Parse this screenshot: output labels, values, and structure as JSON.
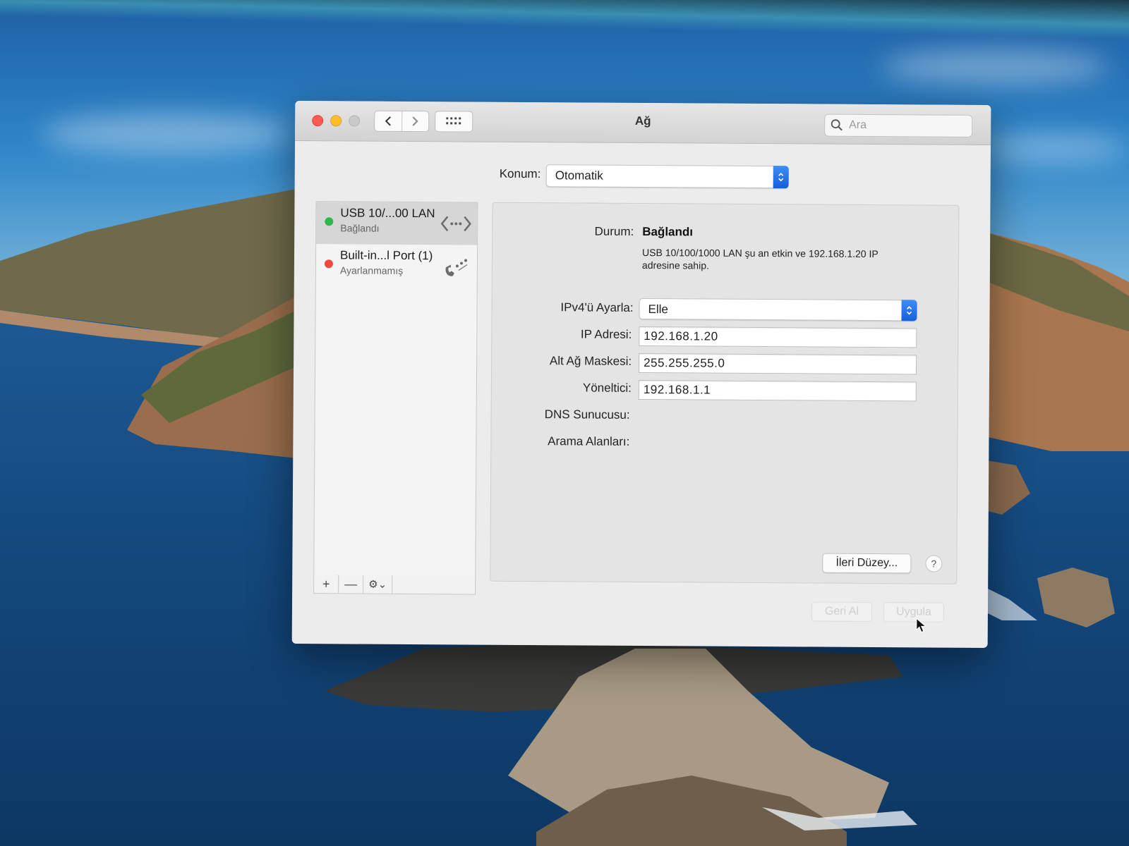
{
  "window": {
    "title": "Ağ",
    "search_placeholder": "Ara"
  },
  "location": {
    "label": "Konum:",
    "value": "Otomatik"
  },
  "services": [
    {
      "name": "USB 10/...00 LAN",
      "status": "Bağlandı",
      "status_color": "#2fb84a",
      "icon": "ethernet-icon",
      "selected": true
    },
    {
      "name": "Built-in...l Port (1)",
      "status": "Ayarlanmamış",
      "status_color": "#f04b3e",
      "icon": "phone-modem-icon",
      "selected": false
    }
  ],
  "sidebar_tools": {
    "add": "+",
    "remove": "—",
    "gear_caret": "⌄"
  },
  "detail": {
    "status_label": "Durum:",
    "status_value": "Bağlandı",
    "status_description": "USB 10/100/1000 LAN şu an etkin ve 192.168.1.20 IP adresine sahip.",
    "configure_ipv4_label": "IPv4'ü Ayarla:",
    "configure_ipv4_value": "Elle",
    "ip_label": "IP Adresi:",
    "ip_value": "192.168.1.20",
    "subnet_label": "Alt Ağ Maskesi:",
    "subnet_value": "255.255.255.0",
    "router_label": "Yöneltici:",
    "router_value": "192.168.1.1",
    "dns_label": "DNS Sunucusu:",
    "search_domains_label": "Arama Alanları:",
    "advanced_button": "İleri Düzey...",
    "help_button": "?"
  },
  "footer": {
    "revert_button": "Geri Al",
    "apply_button": "Uygula"
  },
  "colors": {
    "accent": "#1c6fe8",
    "close": "#ff5b52",
    "minimize": "#ffbd2e",
    "zoom_inactive": "#c9c9c9"
  }
}
